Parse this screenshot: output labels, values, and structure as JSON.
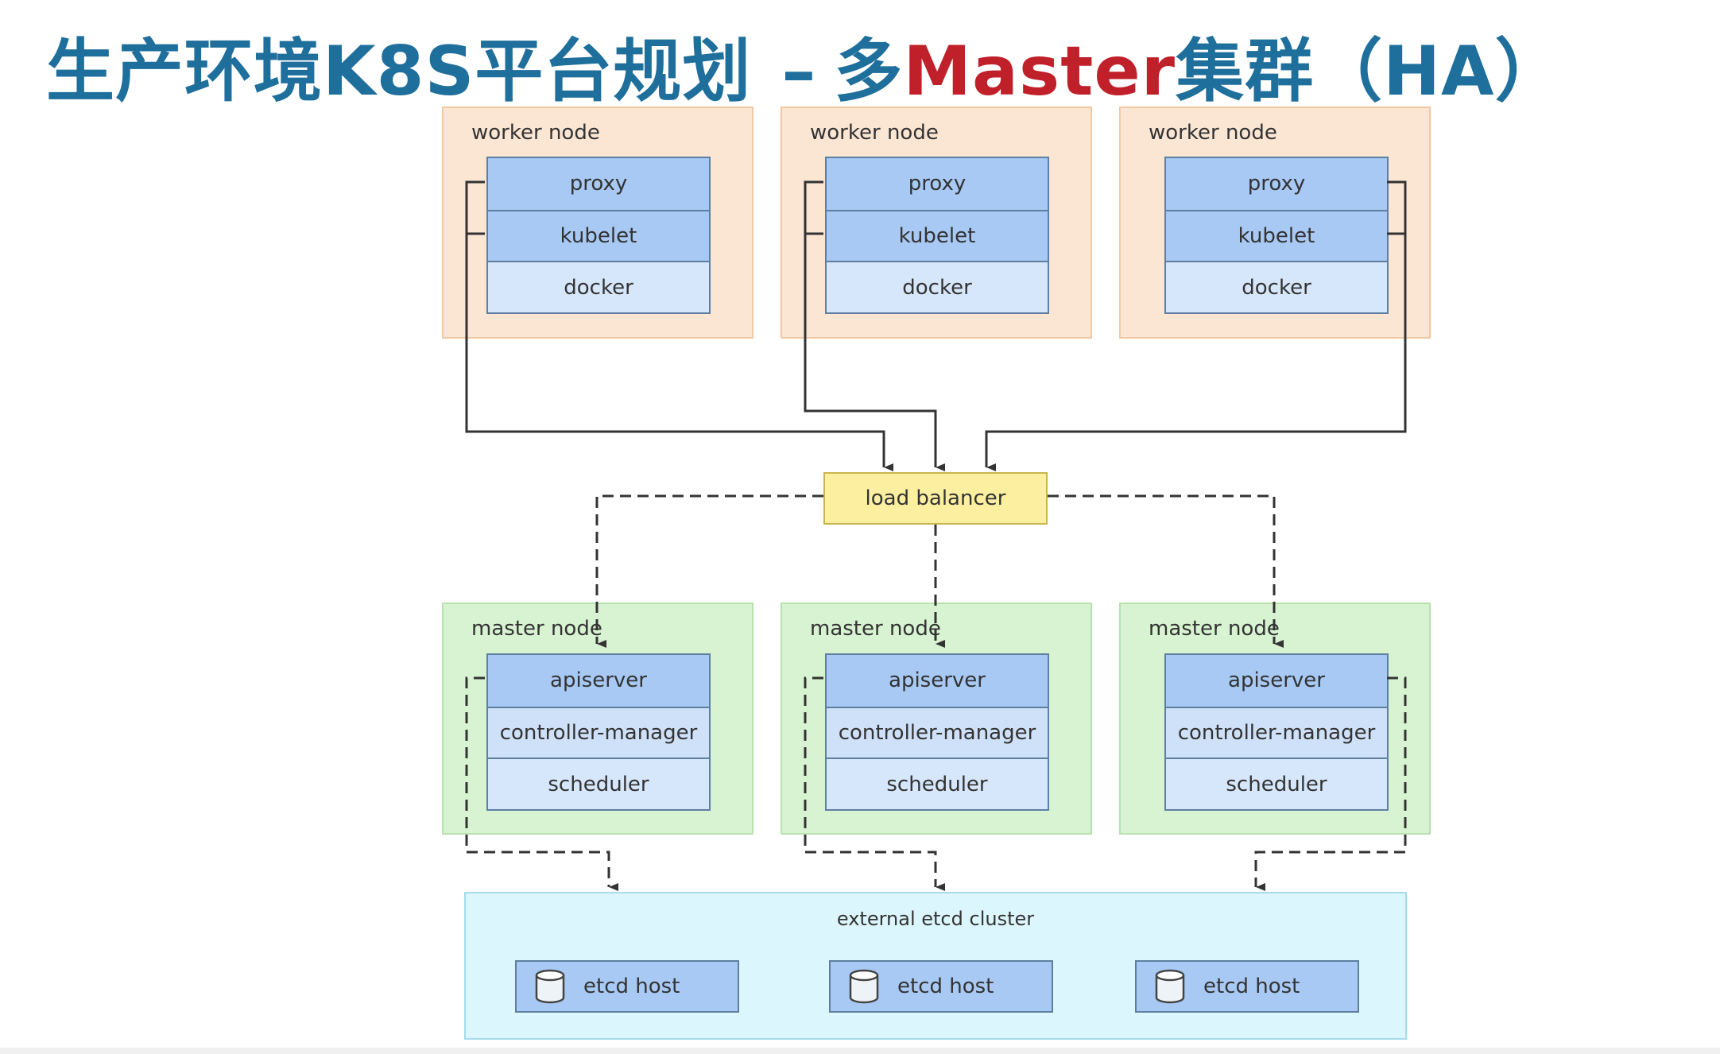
{
  "title": {
    "part1": "生产环境K8S平台规划",
    "dash": "–",
    "part2": "多",
    "part3": "Master",
    "part4": "集群（HA）"
  },
  "worker_nodes": [
    {
      "label": "worker node",
      "components": [
        "proxy",
        "kubelet",
        "docker"
      ]
    },
    {
      "label": "worker node",
      "components": [
        "proxy",
        "kubelet",
        "docker"
      ]
    },
    {
      "label": "worker node",
      "components": [
        "proxy",
        "kubelet",
        "docker"
      ]
    }
  ],
  "load_balancer": {
    "label": "load balancer"
  },
  "master_nodes": [
    {
      "label": "master node",
      "components": [
        "apiserver",
        "controller-manager",
        "scheduler"
      ]
    },
    {
      "label": "master node",
      "components": [
        "apiserver",
        "controller-manager",
        "scheduler"
      ]
    },
    {
      "label": "master node",
      "components": [
        "apiserver",
        "controller-manager",
        "scheduler"
      ]
    }
  ],
  "etcd_cluster": {
    "label": "external etcd cluster",
    "hosts": [
      {
        "label": "etcd host"
      },
      {
        "label": "etcd host"
      },
      {
        "label": "etcd host"
      }
    ]
  },
  "colors": {
    "title_blue": "#1f6f9c",
    "title_red": "#c0202a",
    "worker_bg": "#fbe6d4",
    "master_bg": "#d7f3d1",
    "etcd_bg": "#dcf6fd",
    "component_blue": "#a7c9f4",
    "load_balancer_yellow": "#fcf0a0"
  }
}
